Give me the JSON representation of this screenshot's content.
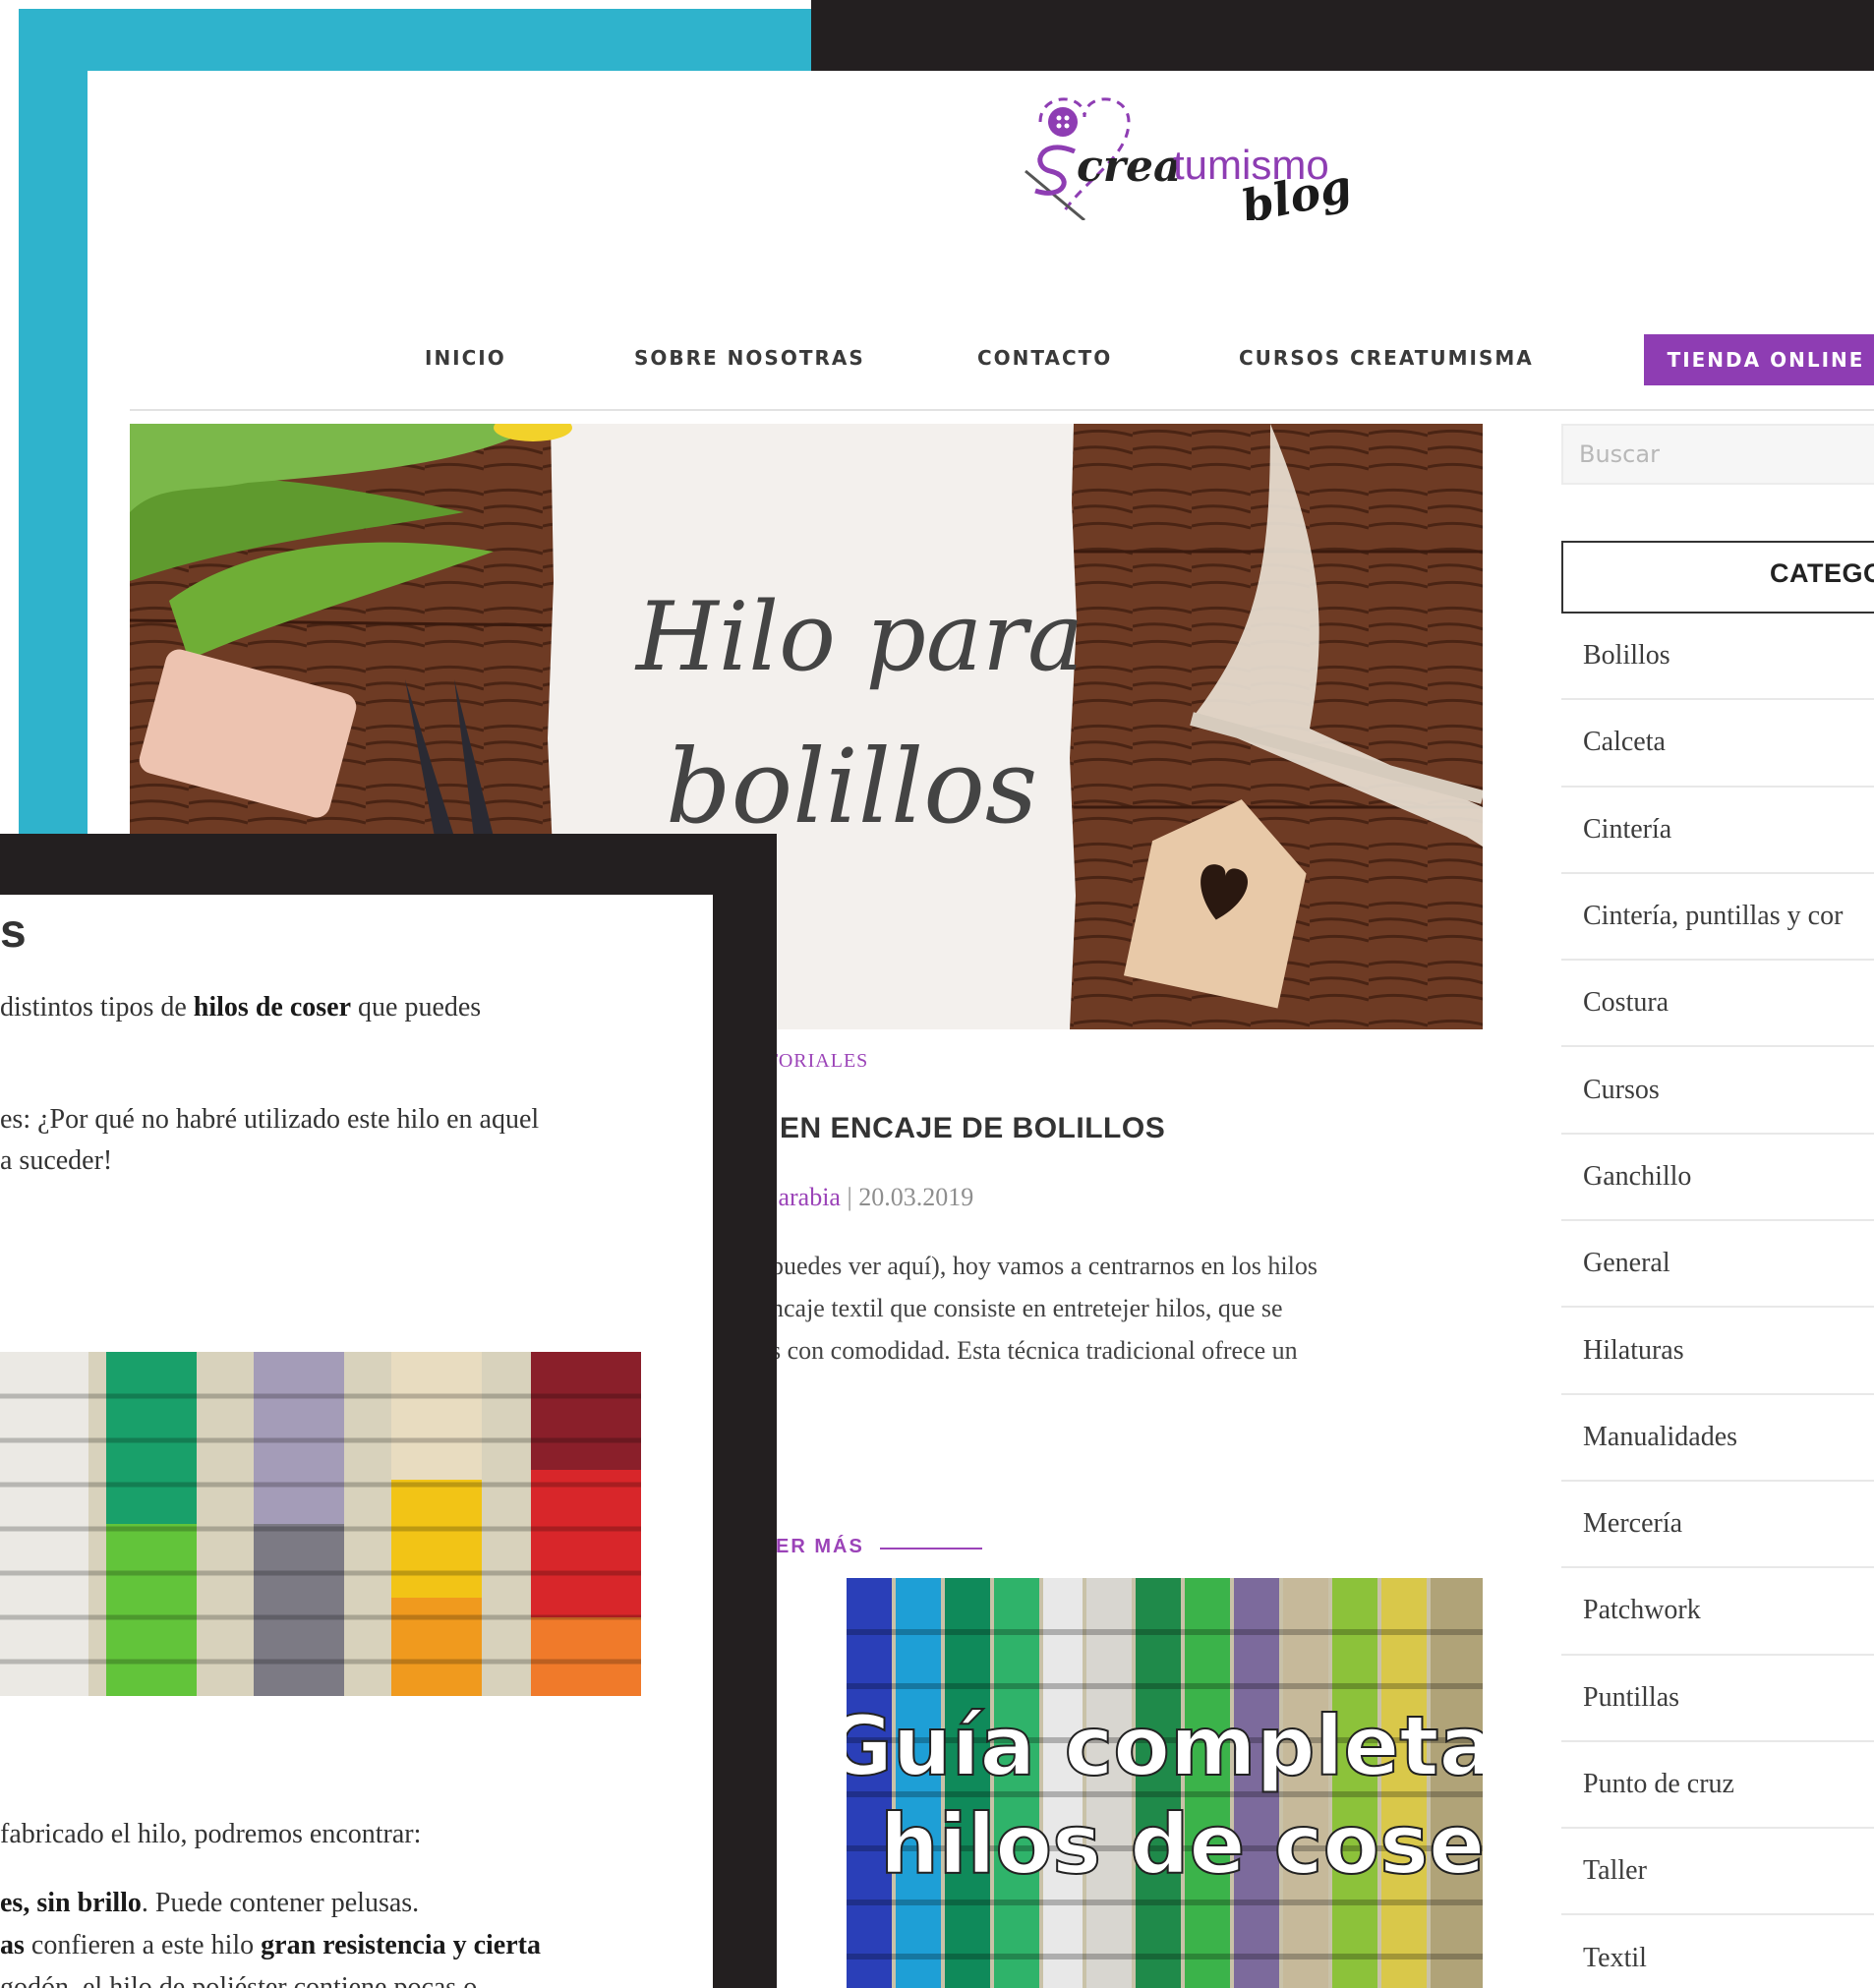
{
  "site": {
    "logo_main": "creatumismo",
    "logo_script": "blog"
  },
  "nav": {
    "items": [
      "INICIO",
      "SOBRE NOSOTRAS",
      "CONTACTO",
      "CURSOS CREATUMISMA"
    ],
    "shop": "TIENDA ONLINE"
  },
  "featured": {
    "image_text_line1": "Hilo para",
    "image_text_line2": "bolillos",
    "category": "TORIALES",
    "title": "EN ENCAJE DE BOLILLOS",
    "author": "Sarabia",
    "separator": "|",
    "date": "20.03.2019",
    "excerpt": [
      "puedes ver aquí), hoy vamos a centrarnos en los hilos",
      "ncaje textil que consiste en entretejer hilos, que se",
      "s con comodidad. Esta técnica tradicional ofrece un"
    ],
    "read_more": "ER MÁS"
  },
  "second_post": {
    "image_text_line1": "Guía completa de",
    "image_text_line2": "hilos de coser"
  },
  "sidebar": {
    "search_placeholder": "Buscar",
    "categories_heading": "CATEGO",
    "categories": [
      "Bolillos",
      "Calceta",
      "Cintería",
      "Cintería, puntillas y cor",
      "Costura",
      "Cursos",
      "Ganchillo",
      "General",
      "Hilaturas",
      "Manualidades",
      "Mercería",
      "Patchwork",
      "Puntillas",
      "Punto de cruz",
      "Taller",
      "Textil"
    ]
  },
  "overlay": {
    "heading_fragment": "s",
    "para1_pre": "distintos tipos de ",
    "para1_bold": "hilos de coser",
    "para1_post": " que puedes",
    "para2_line1": "es: ¿Por qué no habré utilizado este hilo en aquel",
    "para2_line2": "a suceder!",
    "para3": "fabricado el hilo, podremos encontrar:",
    "item1_bold": "es, sin brillo",
    "item1_post": ". Puede contener pelusas.",
    "item2_bold1": "as",
    "item2_mid": " confieren a este hilo ",
    "item2_bold2": "gran resistencia y cierta",
    "item3": "godón, el hilo de poliéster contiene pocas o"
  }
}
